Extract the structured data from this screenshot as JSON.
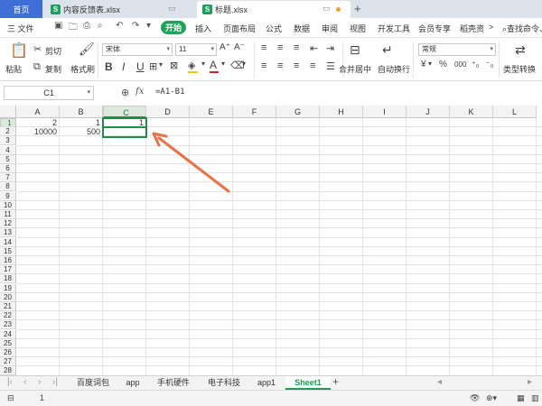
{
  "tabs": {
    "home": "首页",
    "file1": "内容反馈表.xlsx",
    "file2": "标题.xlsx",
    "file_icon": "S"
  },
  "menu": {
    "file": "三 文件",
    "start": "开始",
    "insert": "插入",
    "layout": "页面布局",
    "formula": "公式",
    "data": "数据",
    "review": "审阅",
    "view": "视图",
    "devtools": "开发工具",
    "member": "会员专享",
    "shell": "稻壳资",
    "more": ">",
    "search": "查找命令、"
  },
  "ribbon": {
    "paste": "粘贴",
    "cut": "剪切",
    "copy": "复制",
    "format_painter": "格式刷",
    "font_name": "宋体",
    "font_size": "11",
    "bold": "B",
    "italic": "I",
    "underline": "U",
    "font_color": "A",
    "merge_center": "合并居中",
    "wrap": "自动换行",
    "number_format": "常规",
    "percent": "%",
    "thousand": "000",
    "currency": "¥",
    "type_convert": "类型转换"
  },
  "formula_bar": {
    "name_box": "C1",
    "fx": "fx",
    "formula": "=A1-B1"
  },
  "columns": [
    "A",
    "B",
    "C",
    "D",
    "E",
    "F",
    "G",
    "H",
    "I",
    "J",
    "K",
    "L"
  ],
  "rows": [
    "1",
    "2",
    "3",
    "4",
    "5",
    "6",
    "7",
    "8",
    "9",
    "10",
    "11",
    "12",
    "13",
    "14",
    "15",
    "16",
    "17",
    "18",
    "19",
    "20",
    "21",
    "22",
    "23",
    "24",
    "25",
    "26",
    "27",
    "28"
  ],
  "cells": {
    "A1": "2",
    "B1": "1",
    "C1": "1",
    "A2": "10000",
    "B2": "500"
  },
  "sheets": [
    "百度词包",
    "app",
    "手机硬件",
    "电子科技",
    "app1",
    "Sheet1"
  ],
  "active_sheet": "Sheet1",
  "status": {
    "value": "1"
  },
  "colors": {
    "accent_green": "#1f8c4c",
    "home_tab_blue": "#3d6fd6",
    "annotation_arrow": "#e8734a"
  }
}
